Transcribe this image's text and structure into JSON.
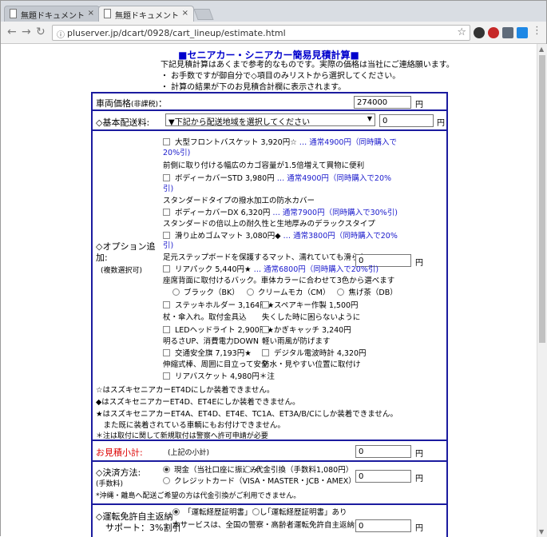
{
  "browser": {
    "tabs": [
      {
        "title": "無題ドキュメント"
      },
      {
        "title": "無題ドキュメント"
      }
    ],
    "close_glyph": "×",
    "url": "pluserver.jp/dcart/0928/cart_lineup/estimate.html"
  },
  "page": {
    "title": "■セニアカー・シニアカー簡易見積計算■",
    "intro": [
      "下記見積計算はあくまで参考的なものです。実際の価格は当社にご連絡願います。",
      "・ お手数ですが御自分で◇項目のみリストから選択してください。",
      "・ 計算の結果が下のお見積合計欄に表示されます。"
    ]
  },
  "vehicle": {
    "label": "車両価格",
    "sub": "(非課税)",
    "colon": "：",
    "value": "274000",
    "unit": "円"
  },
  "shipping": {
    "label": "◇基本配送料:",
    "select_text": "▼下記から配送地域を選択してください",
    "value": "0",
    "unit": "円"
  },
  "options": {
    "label_line1": "◇オプション追",
    "label_line2": "加:",
    "sub": "(複数選択可)",
    "value": "0",
    "unit": "円",
    "items": {
      "front_basket": {
        "name": "大型フロントバスケット 3,920円☆",
        "price": " … 通常4900円（同時購入で",
        "price2": "20%引)",
        "desc": "前側に取り付ける幅広のカゴ容量が1.5倍増えて買物に便利"
      },
      "cover_std": {
        "name": "ボディーカバーSTD 3,980円",
        "price": " … 通常4900円（同時購入で20%",
        "price2": "引)",
        "desc": "スタンダードタイプの撥水加工の防水カバー"
      },
      "cover_dx": {
        "name": "ボディーカバーDX 6,320円",
        "price": " … 通常7900円（同時購入で30%引)",
        "desc": "スタンダードの倍以上の耐久性と生地厚みのデラックスタイプ"
      },
      "mat": {
        "name": "滑り止めゴムマット 3,080円◆",
        "price": " … 通常3800円（同時購入で20%",
        "price2": "引)",
        "desc": "足元ステップボードを保護するマット、濡れていても滑らない"
      },
      "rear_pack": {
        "name": "リアパック 5,440円★",
        "price": " … 通常6800円（同時購入で20%引)",
        "desc": "座席背面に取付けるバック。車体カラーに合わせて3色から選べます",
        "colors": [
          "ブラック（BK）",
          "クリームモカ（CM）",
          "焦げ茶（DB）"
        ]
      },
      "stick_holder": {
        "name": "ステッキホルダー 3,164円★",
        "desc": "杖・傘入れ。取付金具込"
      },
      "spare_key": {
        "name": "スペアキー作製 1,500円",
        "desc": "失くした時に困らないように"
      },
      "led": {
        "name": "LEDヘッドライト 2,900円★",
        "desc": "明るさUP、消費電力DOWN"
      },
      "key_catch": {
        "name": "かぎキャッチ 3,240円",
        "desc": "軽い雨風が防げます"
      },
      "flag": {
        "name": "交通安全旗 7,193円★",
        "desc": "伸縮式棒、周囲に目立って安全"
      },
      "meter": {
        "name": "デジタル電波時計 4,320円",
        "desc": "防水・見やすい位置に取付け"
      },
      "rear_basket": {
        "name": "リアバスケット 4,980円＊注"
      }
    },
    "notes": [
      "☆はスズキセニアカーET4Dにしか装着できません。",
      "◆はスズキセニアカーET4D、ET4Eにしか装着できません。",
      "★はスズキセニアカーET4A、ET4D、ET4E、TC1A、ET3A/B/Cにしか装着できません。",
      "　また既に装着されている車輌にもお付けできません。",
      "＊注は取付に関して新規取付は警察へ許可申請が必要"
    ]
  },
  "subtotal": {
    "label": "お見積小計:",
    "sub": "(上記の小計)",
    "value": "0",
    "unit": "円"
  },
  "payment": {
    "label": "◇決済方法:",
    "sub": "(手数料)",
    "options": [
      "現金（当社口座に振込み）",
      "代金引換（手数料1,080円）",
      "クレジットカード（VISA・MASTER・JCB・AMEX）"
    ],
    "note": "*沖縄・離島へ配送ご希望の方は代金引換がご利用できません。",
    "value": "0",
    "unit": "円"
  },
  "license": {
    "label_line1": "◇運転免許自主返納",
    "label_line2": "サポート：3%割引",
    "options": [
      "「運転経歴証明書」なし",
      "「運転経歴証明書」あり"
    ],
    "desc": "本サービスは、全国の警察・高齢者運転免許自主返納サポート協議",
    "value": "0",
    "unit": "円"
  }
}
